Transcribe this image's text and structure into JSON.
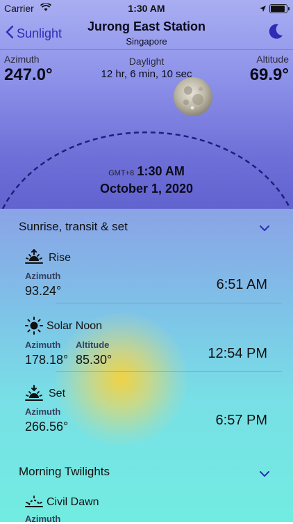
{
  "status_bar": {
    "carrier": "Carrier",
    "time": "1:30 AM"
  },
  "nav": {
    "back_label": "Sunlight",
    "title": "Jurong East Station",
    "subtitle": "Singapore"
  },
  "summary": {
    "azimuth_label": "Azimuth",
    "azimuth_value": "247.0°",
    "daylight_label": "Daylight",
    "daylight_value": "12 hr, 6 min, 10 sec",
    "altitude_label": "Altitude",
    "altitude_value": "69.9°",
    "timezone": "GMT+8",
    "current_time": "1:30 AM",
    "current_date": "October 1, 2020"
  },
  "sections": {
    "rise_transit_set": {
      "title": "Sunrise, transit & set"
    },
    "morning_twilights": {
      "title": "Morning Twilights"
    }
  },
  "events": {
    "rise": {
      "title": "Rise",
      "azimuth_label": "Azimuth",
      "azimuth": "93.24°",
      "time": "6:51 AM"
    },
    "noon": {
      "title": "Solar Noon",
      "azimuth_label": "Azimuth",
      "azimuth": "178.18°",
      "altitude_label": "Altitude",
      "altitude": "85.30°",
      "time": "12:54 PM"
    },
    "set": {
      "title": "Set",
      "azimuth_label": "Azimuth",
      "azimuth": "266.56°",
      "time": "6:57 PM"
    },
    "civil_dawn": {
      "title": "Civil Dawn",
      "azimuth_label": "Azimuth"
    }
  },
  "colors": {
    "accent": "#2f2bb5",
    "arc": "#1f1f7a"
  }
}
